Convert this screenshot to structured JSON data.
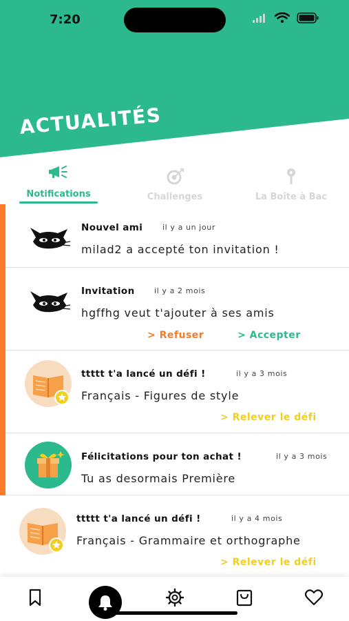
{
  "status_bar": {
    "time": "7:20"
  },
  "header": {
    "title": "ACTUALITÉS"
  },
  "colors": {
    "brand": "#2cb98d",
    "accent_orange": "#f47a2c",
    "accent_yellow": "#f2cf1e",
    "accept_green": "#2cb98d"
  },
  "tabs": [
    {
      "label": "Notifications",
      "icon": "megaphone-icon",
      "active": true
    },
    {
      "label": "Challenges",
      "icon": "target-icon",
      "active": false
    },
    {
      "label": "La Boîte à Bac",
      "icon": "pin-icon",
      "active": false
    }
  ],
  "notifications": [
    {
      "title": "Nouvel ami",
      "time": "il y a  un jour",
      "body": "milad2 a accepté ton invitation !",
      "avatar": "cat-icon"
    },
    {
      "title": "Invitation",
      "time": "il y a  2 mois",
      "body": "hgffhg veut t'ajouter à ses amis",
      "avatar": "cat-icon",
      "actions": {
        "refuse": "> Refuser",
        "accept": "> Accepter"
      }
    },
    {
      "title": "ttttt t'a lancé un défi !",
      "time": "il y a  3 mois",
      "body": "Français - Figures de style",
      "avatar": "book-star-icon",
      "actions": {
        "challenge": "> Relever le défi"
      }
    },
    {
      "title": "Félicitations pour ton achat !",
      "time": "il y a  3 mois",
      "body": "Tu as desormais Première",
      "avatar": "gift-icon"
    },
    {
      "title": "ttttt t'a lancé un défi !",
      "time": "il y a  4 mois",
      "body": "Français - Grammaire et orthographe",
      "avatar": "book-star-icon",
      "actions": {
        "challenge": "> Relever le défi"
      }
    }
  ],
  "bottom_nav": [
    {
      "icon": "bookmark-icon"
    },
    {
      "icon": "bell-icon",
      "active": true
    },
    {
      "icon": "gear-icon"
    },
    {
      "icon": "bag-icon"
    },
    {
      "icon": "heart-icon"
    }
  ]
}
